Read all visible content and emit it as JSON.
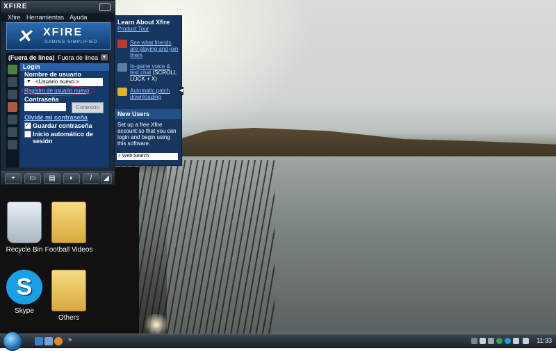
{
  "xfire": {
    "logo_small": "XFIRE",
    "menu": [
      "Xfire",
      "Herramientas",
      "Ayuda"
    ],
    "banner_brand": "XFIRE",
    "banner_tagline": "GAMING SIMPLIFIED",
    "status_label": "(Fuera de línea)",
    "status_value": "Fuera de línea",
    "login_header": "Login",
    "username_label": "Nombre de usuario",
    "username_value": "<Usuario nuevo >",
    "register_link": "Registro de usuario nuevo",
    "password_label": "Contraseña",
    "connect_button": "Conexión",
    "forgot_link": "Olvidé mi contraseña",
    "save_password": {
      "label": "Guardar contraseña",
      "checked": true
    },
    "auto_login": {
      "label": "Inicio automático de sesión",
      "checked": false
    }
  },
  "info_panel": {
    "title": "Learn About Xfire",
    "tour_link": "Product Tour",
    "tips": [
      {
        "link": "See what friends are playing and join them",
        "rest": "",
        "color": "#c0392b"
      },
      {
        "link": "In-game voice & text chat",
        "rest": " (SCROLL LOCK + X)",
        "color": "#5b7fa8"
      },
      {
        "link": "Automatic patch downloading",
        "rest": "",
        "color": "#e1b324"
      }
    ],
    "new_users_header": "New Users",
    "new_users_text": "Set up a free Xfire account so that you can login and begin using this software.",
    "search_placeholder": "Web Search"
  },
  "desktop_icons": [
    "Recycle Bin",
    "Football Videos",
    "Skype",
    "Others"
  ],
  "taskbar": {
    "clock": "11:33"
  }
}
